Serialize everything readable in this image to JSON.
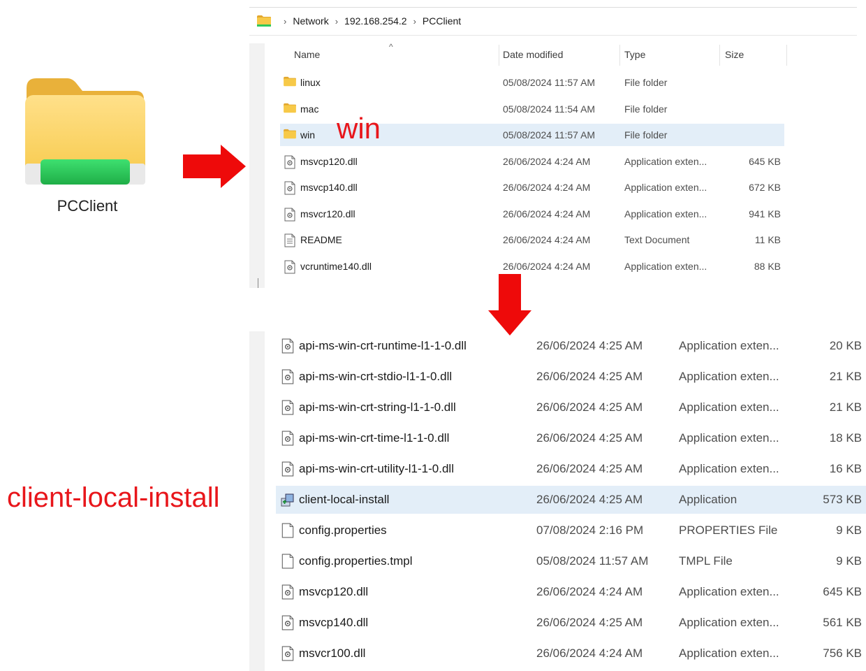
{
  "desktop": {
    "folder_label": "PCClient"
  },
  "breadcrumb": [
    "Network",
    "192.168.254.2",
    "PCClient"
  ],
  "columns": {
    "name": "Name",
    "date": "Date modified",
    "type": "Type",
    "size": "Size"
  },
  "top_files": [
    {
      "name": "linux",
      "date": "05/08/2024 11:57 AM",
      "type": "File folder",
      "size": "",
      "icon": "folder-icon",
      "selected": false
    },
    {
      "name": "mac",
      "date": "05/08/2024 11:54 AM",
      "type": "File folder",
      "size": "",
      "icon": "folder-icon",
      "selected": false
    },
    {
      "name": "win",
      "date": "05/08/2024 11:57 AM",
      "type": "File folder",
      "size": "",
      "icon": "folder-icon",
      "selected": true
    },
    {
      "name": "msvcp120.dll",
      "date": "26/06/2024 4:24 AM",
      "type": "Application exten...",
      "size": "645 KB",
      "icon": "dll-file-icon",
      "selected": false
    },
    {
      "name": "msvcp140.dll",
      "date": "26/06/2024 4:24 AM",
      "type": "Application exten...",
      "size": "672 KB",
      "icon": "dll-file-icon",
      "selected": false
    },
    {
      "name": "msvcr120.dll",
      "date": "26/06/2024 4:24 AM",
      "type": "Application exten...",
      "size": "941 KB",
      "icon": "dll-file-icon",
      "selected": false
    },
    {
      "name": "README",
      "date": "26/06/2024 4:24 AM",
      "type": "Text Document",
      "size": "11 KB",
      "icon": "text-file-icon",
      "selected": false
    },
    {
      "name": "vcruntime140.dll",
      "date": "26/06/2024 4:24 AM",
      "type": "Application exten...",
      "size": "88 KB",
      "icon": "dll-file-icon",
      "selected": false
    }
  ],
  "bottom_files": [
    {
      "name": "api-ms-win-crt-runtime-l1-1-0.dll",
      "date": "26/06/2024 4:25 AM",
      "type": "Application exten...",
      "size": "20 KB",
      "icon": "dll-file-icon",
      "selected": false
    },
    {
      "name": "api-ms-win-crt-stdio-l1-1-0.dll",
      "date": "26/06/2024 4:25 AM",
      "type": "Application exten...",
      "size": "21 KB",
      "icon": "dll-file-icon",
      "selected": false
    },
    {
      "name": "api-ms-win-crt-string-l1-1-0.dll",
      "date": "26/06/2024 4:25 AM",
      "type": "Application exten...",
      "size": "21 KB",
      "icon": "dll-file-icon",
      "selected": false
    },
    {
      "name": "api-ms-win-crt-time-l1-1-0.dll",
      "date": "26/06/2024 4:25 AM",
      "type": "Application exten...",
      "size": "18 KB",
      "icon": "dll-file-icon",
      "selected": false
    },
    {
      "name": "api-ms-win-crt-utility-l1-1-0.dll",
      "date": "26/06/2024 4:25 AM",
      "type": "Application exten...",
      "size": "16 KB",
      "icon": "dll-file-icon",
      "selected": false
    },
    {
      "name": "client-local-install",
      "date": "26/06/2024 4:25 AM",
      "type": "Application",
      "size": "573 KB",
      "icon": "installer-icon",
      "selected": true
    },
    {
      "name": "config.properties",
      "date": "07/08/2024 2:16 PM",
      "type": "PROPERTIES File",
      "size": "9 KB",
      "icon": "blank-file-icon",
      "selected": false
    },
    {
      "name": "config.properties.tmpl",
      "date": "05/08/2024 11:57 AM",
      "type": "TMPL File",
      "size": "9 KB",
      "icon": "blank-file-icon",
      "selected": false
    },
    {
      "name": "msvcp120.dll",
      "date": "26/06/2024 4:24 AM",
      "type": "Application exten...",
      "size": "645 KB",
      "icon": "dll-file-icon",
      "selected": false
    },
    {
      "name": "msvcp140.dll",
      "date": "26/06/2024 4:25 AM",
      "type": "Application exten...",
      "size": "561 KB",
      "icon": "dll-file-icon",
      "selected": false
    },
    {
      "name": "msvcr100.dll",
      "date": "26/06/2024 4:24 AM",
      "type": "Application exten...",
      "size": "756 KB",
      "icon": "dll-file-icon",
      "selected": false
    }
  ],
  "annotations": {
    "win": "win",
    "client": "client-local-install"
  },
  "colors": {
    "annotation": "#e8161b",
    "arrow": "#ee0a0a",
    "selection": "#e3eef8",
    "folder": "#f7c948",
    "folder_band": "#2fc85a"
  }
}
